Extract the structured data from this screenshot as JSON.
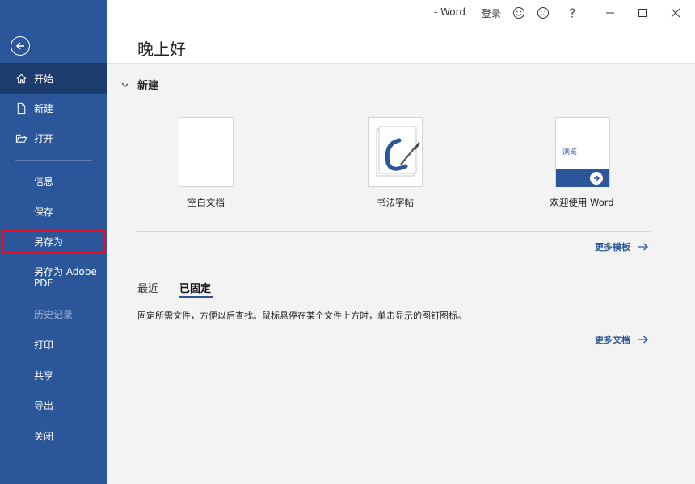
{
  "titlebar": {
    "app_title": "- Word",
    "signin": "登录"
  },
  "sidebar": {
    "items": [
      {
        "label": "开始"
      },
      {
        "label": "新建"
      },
      {
        "label": "打开"
      },
      {
        "label": "信息"
      },
      {
        "label": "保存"
      },
      {
        "label": "另存为"
      },
      {
        "label": "另存为 Adobe PDF"
      },
      {
        "label": "历史记录"
      },
      {
        "label": "打印"
      },
      {
        "label": "共享"
      },
      {
        "label": "导出"
      },
      {
        "label": "关闭"
      }
    ]
  },
  "main": {
    "greeting": "晚上好",
    "new_section": "新建",
    "templates": [
      {
        "label": "空白文档"
      },
      {
        "label": "书法字帖"
      },
      {
        "label": "欢迎使用 Word",
        "thumb_text": "浏览"
      }
    ],
    "more_templates": "更多模板",
    "tabs": [
      {
        "label": "最近"
      },
      {
        "label": "已固定"
      }
    ],
    "pinned_hint": "固定所需文件，方便以后查找。鼠标悬停在某个文件上方时，单击显示的图钉图标。",
    "more_documents": "更多文档"
  },
  "colors": {
    "sidebar": "#2b579a",
    "sidebar_active": "#1c3c6e",
    "highlight_box": "#e81123"
  }
}
